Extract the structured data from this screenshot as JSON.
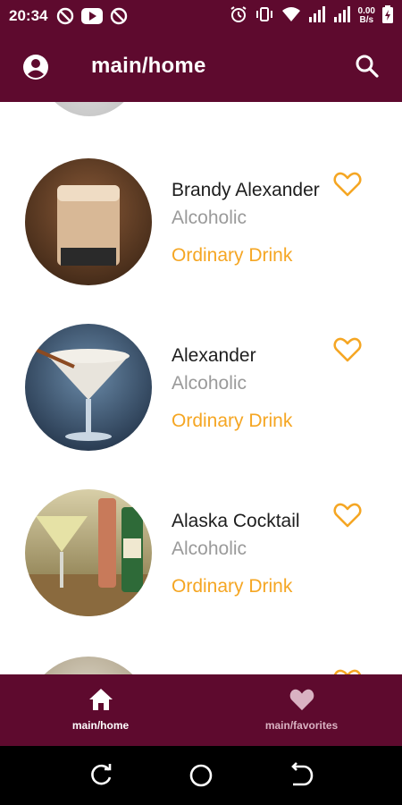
{
  "status_bar": {
    "time": "20:34",
    "net_speed_value": "0.00",
    "net_speed_unit": "B/s"
  },
  "app_bar": {
    "title": "main/home",
    "account_icon": "account-circle-icon",
    "search_icon": "search-icon"
  },
  "drinks": [
    {
      "name": "Brandy Alexander",
      "category": "Alcoholic",
      "type": "Ordinary Drink",
      "favorite": false
    },
    {
      "name": "Alexander",
      "category": "Alcoholic",
      "type": "Ordinary Drink",
      "favorite": false
    },
    {
      "name": "Alaska Cocktail",
      "category": "Alcoholic",
      "type": "Ordinary Drink",
      "favorite": false
    }
  ],
  "bottom_nav": {
    "items": [
      {
        "label": "main/home",
        "icon": "home-icon",
        "active": true
      },
      {
        "label": "main/favorites",
        "icon": "heart-icon",
        "active": false
      }
    ]
  },
  "colors": {
    "primary": "#5e0a2e",
    "accent": "#f5a623",
    "secondary_text": "#9a9a9a",
    "inactive_nav": "#d9b2c2"
  }
}
